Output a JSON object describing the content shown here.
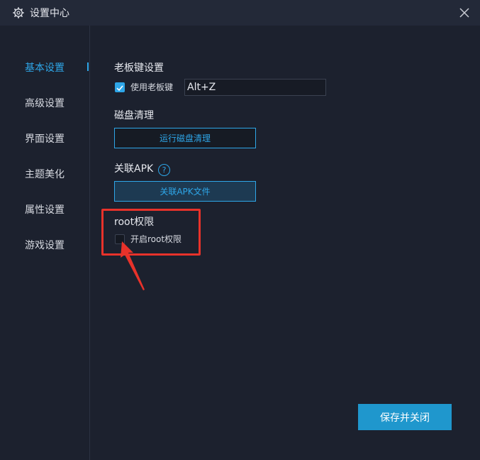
{
  "window": {
    "title": "设置中心"
  },
  "sidebar": {
    "items": [
      {
        "label": "基本设置",
        "active": true
      },
      {
        "label": "高级设置"
      },
      {
        "label": "界面设置"
      },
      {
        "label": "主题美化"
      },
      {
        "label": "属性设置"
      },
      {
        "label": "游戏设置"
      }
    ]
  },
  "boss_key": {
    "section_title": "老板键设置",
    "checkbox_label": "使用老板键",
    "checked": true,
    "hotkey_value": "Alt+Z"
  },
  "disk": {
    "section_title": "磁盘清理",
    "button_label": "运行磁盘清理"
  },
  "apk": {
    "section_title": "关联APK",
    "help_icon": "question-circle-icon",
    "button_label": "关联APK文件"
  },
  "root": {
    "section_title": "root权限",
    "checkbox_label": "开启root权限",
    "checked": false
  },
  "footer": {
    "save_label": "保存并关闭"
  },
  "colors": {
    "accent": "#2ea6e8",
    "background": "#1c212e",
    "titlebar": "#232938",
    "highlight": "#e8322a",
    "save_button": "#1f97cd"
  }
}
